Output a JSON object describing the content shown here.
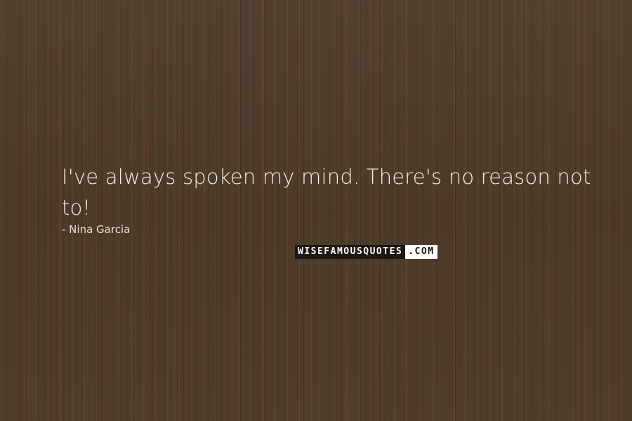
{
  "quote": {
    "text": "I've always spoken my mind. There's no reason not to!",
    "author": "- Nina Garcia"
  },
  "watermark": {
    "main": "WISEFAMOUSQUOTES",
    "tld": ".COM"
  },
  "colors": {
    "background": "#4f3d2b",
    "text": "#f4efe6"
  }
}
